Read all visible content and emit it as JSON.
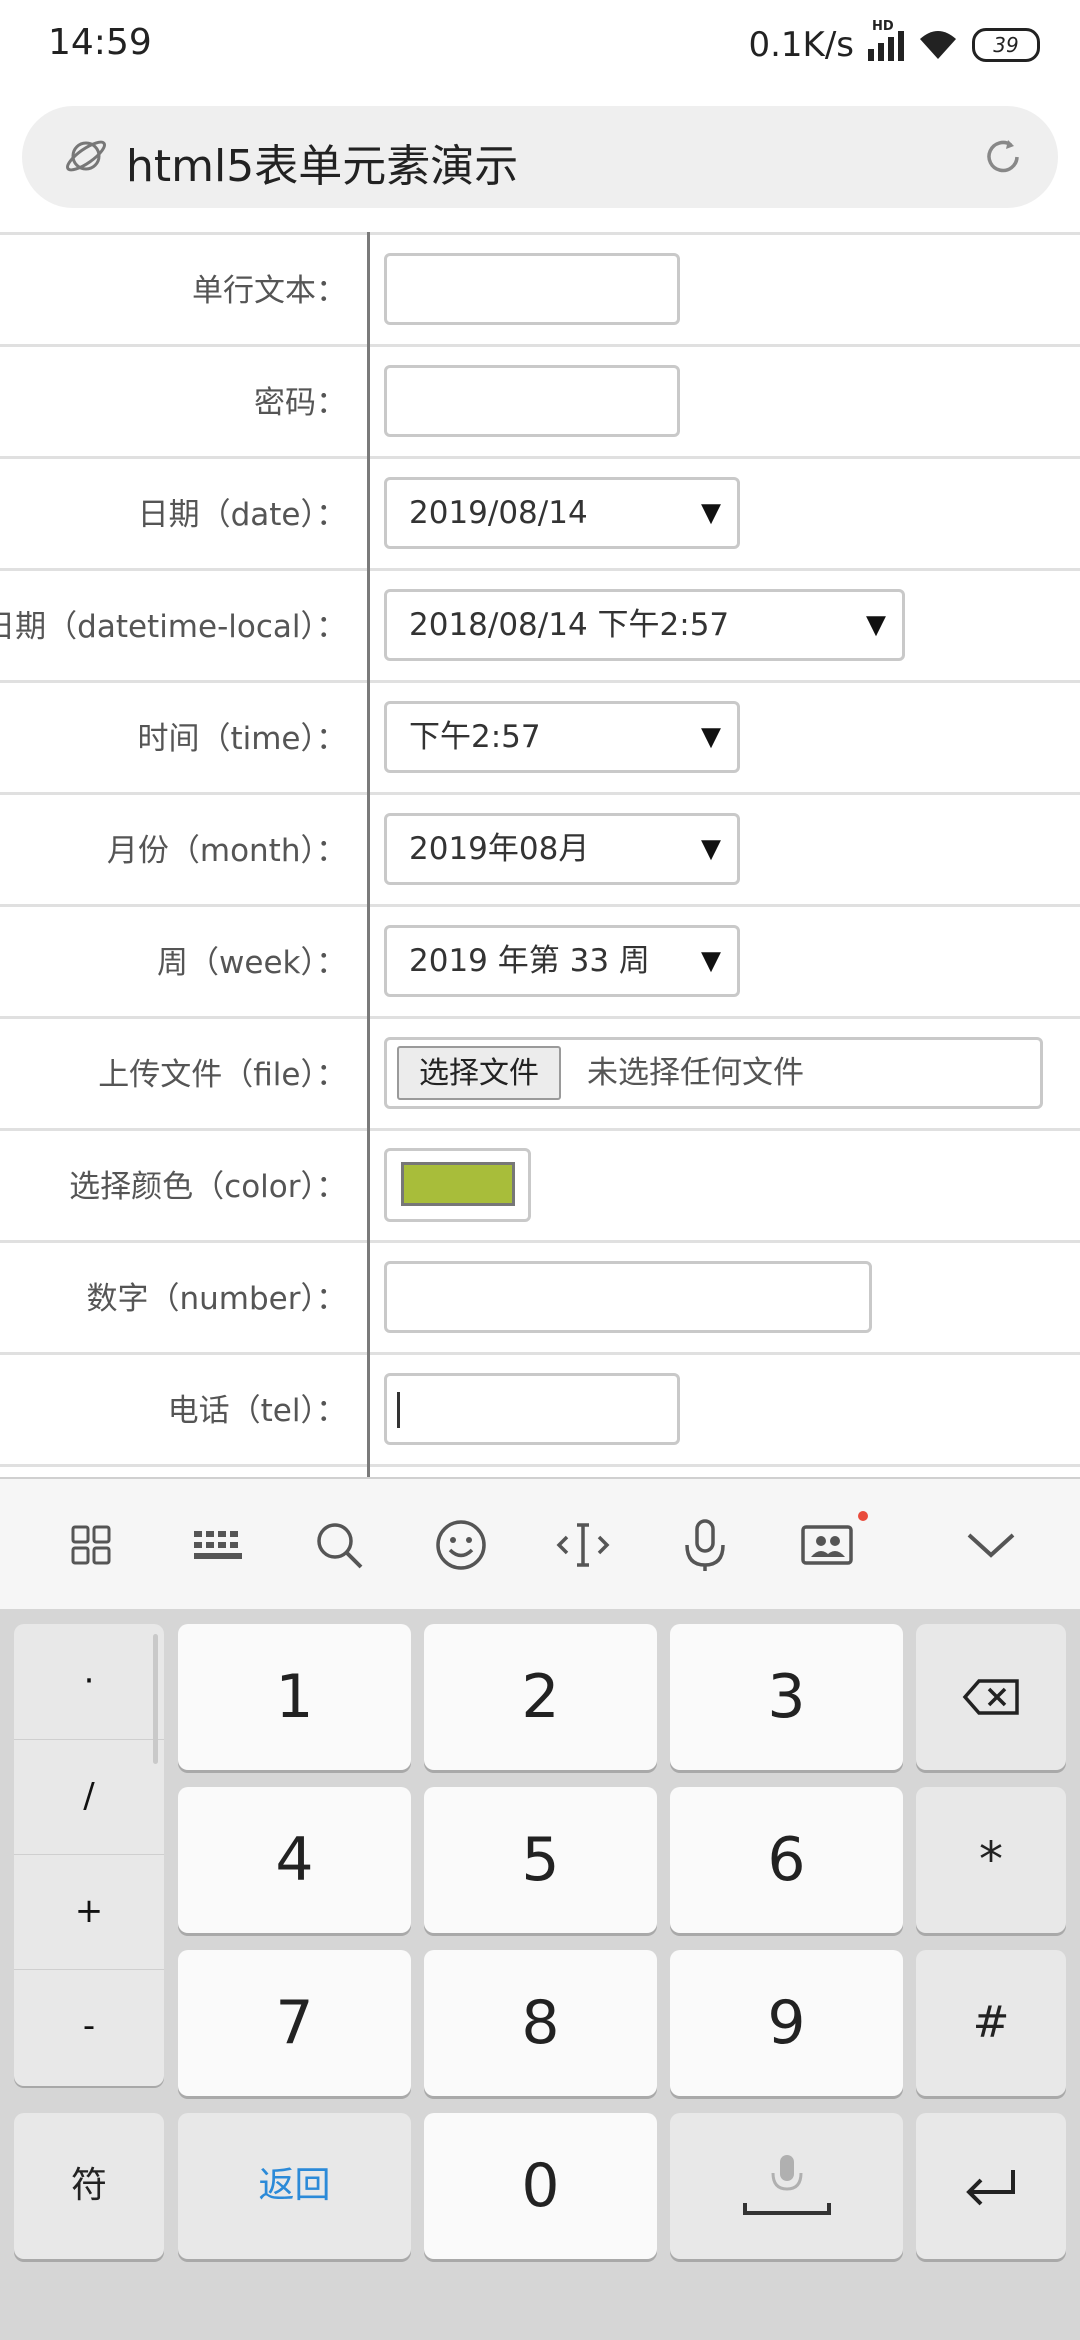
{
  "status_bar": {
    "time": "14:59",
    "net_speed": "0.1K/s",
    "hd_label": "HD",
    "battery": "39"
  },
  "browser": {
    "page_title": "html5表单元素演示"
  },
  "form": {
    "rows": [
      {
        "label": "单行文本：",
        "value": ""
      },
      {
        "label": "密码：",
        "value": ""
      },
      {
        "label": "日期（date）：",
        "value": "2019/08/14"
      },
      {
        "label": "日期（datetime-local）：",
        "value": "2018/08/14 下午2:57"
      },
      {
        "label": "时间（time）：",
        "value": "下午2:57"
      },
      {
        "label": "月份（month）：",
        "value": "2019年08月"
      },
      {
        "label": "周（week）：",
        "value": "2019 年第 33 周"
      },
      {
        "label": "上传文件（file）：",
        "button": "选择文件",
        "value": "未选择任何文件"
      },
      {
        "label": "选择颜色（color）：",
        "value": "#a8bd3a"
      },
      {
        "label": "数字（number）：",
        "value": ""
      },
      {
        "label": "电话（tel）：",
        "value": ""
      },
      {
        "label": "",
        "value": ""
      }
    ],
    "dropdown_arrow": "▼"
  },
  "keyboard": {
    "toolbar_icons": [
      "grid-icon",
      "keyboard-layout-icon",
      "search-icon",
      "emoji-icon",
      "cursor-icon",
      "microphone-icon",
      "contact-card-icon",
      "collapse-icon"
    ],
    "symbols": [
      "·",
      "/",
      "+",
      "-"
    ],
    "keys": [
      "1",
      "2",
      "3",
      "4",
      "5",
      "6",
      "7",
      "8",
      "9",
      "0"
    ],
    "star": "*",
    "hash": "#",
    "symbol_key": "符",
    "back_key": "返回",
    "accent_color": "#2b8ad8"
  }
}
